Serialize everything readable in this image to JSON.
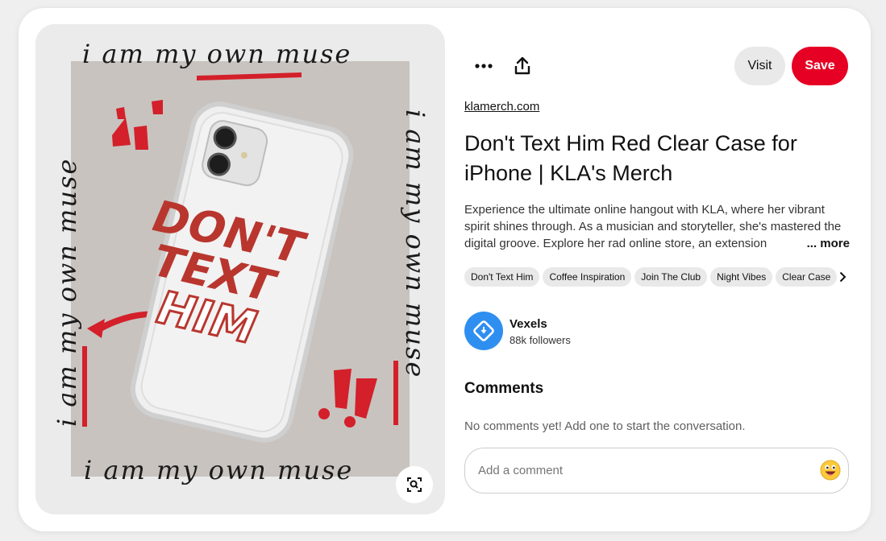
{
  "pin_image": {
    "slogan": "i am my own muse",
    "case_print": [
      "DON'T",
      "TEXT",
      "HIM"
    ],
    "lens_icon": "visual-search-icon"
  },
  "toolbar": {
    "more_icon": "ellipsis-icon",
    "share_icon": "share-icon",
    "visit_label": "Visit",
    "save_label": "Save"
  },
  "pin": {
    "source": "klamerch.com",
    "title": "Don't Text Him Red Clear Case for iPhone | KLA's Merch",
    "description": "Experience the ultimate online hangout with KLA, where her vibrant spirit shines through. As a musician and storyteller, she's mastered the digital groove. Explore her rad online store, an extension",
    "more_label": "... more",
    "tags": [
      "Don't Text Him",
      "Coffee Inspiration",
      "Join The Club",
      "Night Vibes",
      "Clear Case"
    ]
  },
  "creator": {
    "name": "Vexels",
    "followers": "88k followers"
  },
  "comments": {
    "heading": "Comments",
    "empty_text": "No comments yet! Add one to start the conversation.",
    "placeholder": "Add a comment",
    "emoji_icon": "smiley-emoji-icon"
  },
  "colors": {
    "save_red": "#e60023",
    "avatar_blue": "#2f8ff0",
    "print_red": "#b8362e",
    "paint_red": "#d3202a"
  }
}
